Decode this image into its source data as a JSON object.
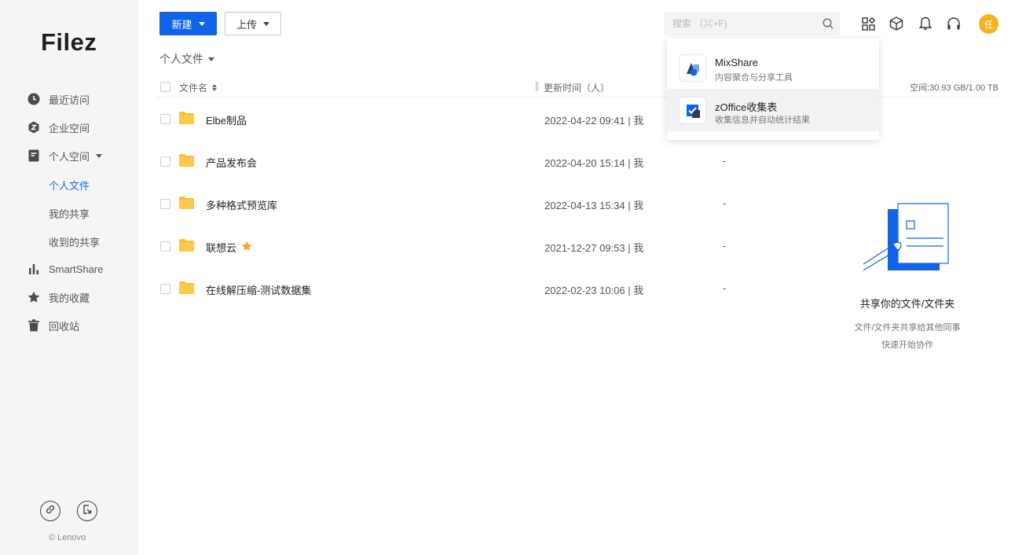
{
  "brand": {
    "logo": "Filez",
    "copyright": "© Lenovo"
  },
  "sidebar": {
    "items": [
      {
        "label": "最近访问",
        "icon": "clock-icon"
      },
      {
        "label": "企业空间",
        "icon": "enterprise-hex-icon"
      },
      {
        "label": "个人空间",
        "icon": "document-icon",
        "expanded": true
      },
      {
        "label": "SmartShare",
        "icon": "bar-chart-icon"
      },
      {
        "label": "我的收藏",
        "icon": "star-icon"
      },
      {
        "label": "回收站",
        "icon": "trash-icon"
      }
    ],
    "sub_items": [
      {
        "label": "个人文件",
        "active": true
      },
      {
        "label": "我的共享"
      },
      {
        "label": "收到的共享"
      }
    ],
    "footer_icons": [
      "link-icon",
      "export-icon"
    ]
  },
  "toolbar": {
    "new_label": "新建",
    "upload_label": "上传"
  },
  "breadcrumb": {
    "label": "个人文件"
  },
  "search": {
    "placeholder": "搜索 （⌘+F)"
  },
  "header_icons": [
    "apps-grid-icon",
    "cube-icon",
    "bell-icon",
    "headset-icon"
  ],
  "user": {
    "avatar_text": "任",
    "avatar_color": "#f5b324"
  },
  "table": {
    "columns": {
      "name": "文件名",
      "time": "更新时间（人）"
    },
    "space": "空间:30.93 GB/1.00 TB",
    "rows": [
      {
        "name": "Elbe制品",
        "time": "2022-04-22 09:41 | 我",
        "dash": "",
        "starred": false
      },
      {
        "name": "产品发布会",
        "time": "2022-04-20 15:14 | 我",
        "dash": "-",
        "starred": false
      },
      {
        "name": "多种格式预览库",
        "time": "2022-04-13 15:34 | 我",
        "dash": "-",
        "starred": false
      },
      {
        "name": "联想云",
        "time": "2021-12-27 09:53 | 我",
        "dash": "-",
        "starred": true
      },
      {
        "name": "在线解压缩-测试数据集",
        "time": "2022-02-23 10:06 | 我",
        "dash": "-",
        "starred": false
      }
    ]
  },
  "dropdown": {
    "items": [
      {
        "title": "MixShare",
        "subtitle": "内容聚合与分享工具",
        "icon": "mixshare-logo-icon"
      },
      {
        "title": "zOffice收集表",
        "subtitle": "收集信息并自动统计结果",
        "icon": "zoffice-form-icon"
      }
    ]
  },
  "empty_panel": {
    "title": "共享你的文件/文件夹",
    "desc_line1": "文件/文件夹共享给其他同事",
    "desc_line2": "快速开始协作"
  },
  "colors": {
    "primary": "#1163e8",
    "folder": "#f7bf3b",
    "star": "#f5a623",
    "active_nav": "#1c6ee6"
  }
}
